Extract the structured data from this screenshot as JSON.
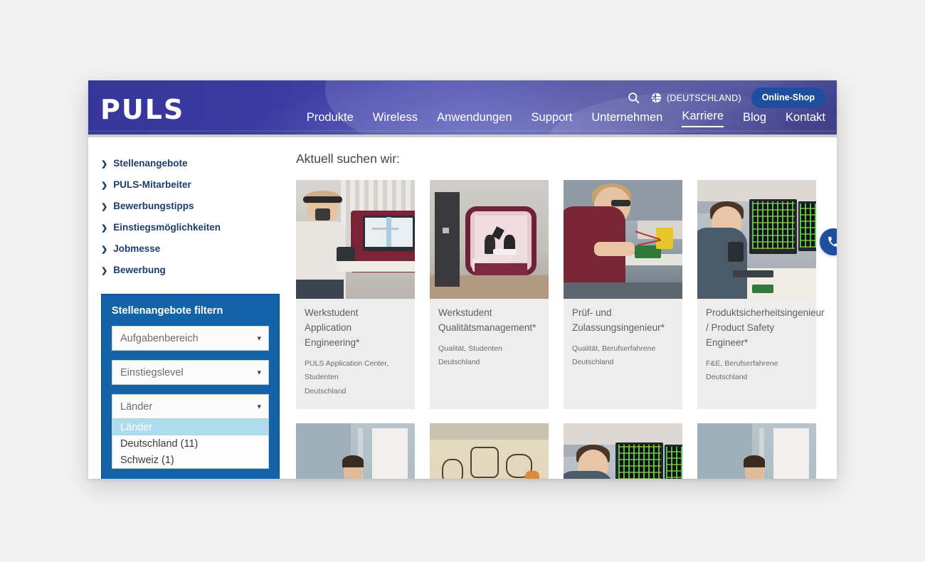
{
  "header": {
    "logo_text": "PULS",
    "search_icon": "search-icon",
    "globe_icon": "globe-icon",
    "locale_label": "(DEUTSCHLAND)",
    "online_shop_label": "Online-Shop",
    "nav_items": [
      {
        "label": "Produkte",
        "active": false
      },
      {
        "label": "Wireless",
        "active": false
      },
      {
        "label": "Anwendungen",
        "active": false
      },
      {
        "label": "Support",
        "active": false
      },
      {
        "label": "Unternehmen",
        "active": false
      },
      {
        "label": "Karriere",
        "active": true
      },
      {
        "label": "Blog",
        "active": false
      },
      {
        "label": "Kontakt",
        "active": false
      }
    ]
  },
  "sidebar": {
    "links": [
      {
        "label": "Stellenangebote"
      },
      {
        "label": "PULS-Mitarbeiter"
      },
      {
        "label": "Bewerbungstipps"
      },
      {
        "label": "Einstiegsmöglichkeiten"
      },
      {
        "label": "Jobmesse"
      },
      {
        "label": "Bewerbung"
      }
    ],
    "filter": {
      "title": "Stellenangebote filtern",
      "selects": [
        {
          "name": "aufgabenbereich",
          "value": "Aufgabenbereich",
          "open": false
        },
        {
          "name": "einstiegslevel",
          "value": "Einstiegslevel",
          "open": false
        },
        {
          "name": "laender",
          "value": "Länder",
          "open": true
        }
      ],
      "country_options": [
        {
          "label": "Länder",
          "selected": true
        },
        {
          "label": "Deutschland  (11)",
          "selected": false
        },
        {
          "label": "Schweiz  (1)",
          "selected": false
        }
      ]
    }
  },
  "main": {
    "page_title": "Aktuell suchen wir:",
    "jobs": [
      {
        "title": "Werkstudent Application Engineering*",
        "meta1": "PULS Application Center, Studenten",
        "meta2": "Deutschland",
        "photo": "call-center-employee"
      },
      {
        "title": "Werkstudent Qualitätsmanagement*",
        "meta1": "Qualität, Studenten",
        "meta2": "Deutschland",
        "photo": "meeting-pod"
      },
      {
        "title": "Prüf- und Zulassungsingenieur*",
        "meta1": "Qualität, Berufserfahrene",
        "meta2": "Deutschland",
        "photo": "lab-technician"
      },
      {
        "title": "Produktsicherheitsingenieur / Product Safety Engineer*",
        "meta1": "F&E, Berufserfahrene",
        "meta2": "Deutschland",
        "photo": "engineer-monitors"
      },
      {
        "title": "",
        "meta1": "",
        "meta2": "",
        "photo": "office-cabinets"
      },
      {
        "title": "",
        "meta1": "",
        "meta2": "",
        "photo": "graffiti-wall"
      },
      {
        "title": "",
        "meta1": "",
        "meta2": "",
        "photo": "engineer-monitors"
      },
      {
        "title": "",
        "meta1": "",
        "meta2": "",
        "photo": "office-cabinets"
      }
    ]
  },
  "contact_fab": {
    "icon": "phone-icon"
  },
  "colors": {
    "header_blue": "#3b3ba3",
    "accent_blue": "#1d4f9e",
    "filter_panel": "#1363a8",
    "sidebar_link": "#1b3d6d",
    "option_highlight": "#addcee",
    "card_bg": "#ededed",
    "page_bg": "#f2f2f2"
  }
}
